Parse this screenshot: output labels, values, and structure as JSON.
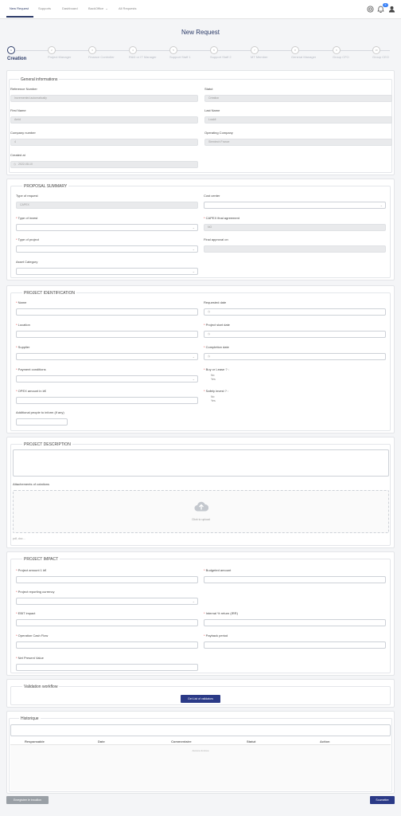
{
  "nav": {
    "tabs": [
      "New Request",
      "Supports",
      "Dashboard",
      "BackOffice",
      "All Requests"
    ],
    "backoffice_chevron": "⌄",
    "notification_count": "0"
  },
  "page_title": "New Request",
  "stepper": {
    "steps": [
      {
        "num": "1",
        "label": "Creation"
      },
      {
        "num": "2",
        "label": "Project Manager"
      },
      {
        "num": "3",
        "label": "Finance Controller"
      },
      {
        "num": "4",
        "label": "R&D or IT Manager"
      },
      {
        "num": "5",
        "label": "Support Staff 1"
      },
      {
        "num": "6",
        "label": "Support Staff 2"
      },
      {
        "num": "7",
        "label": "MT Member"
      },
      {
        "num": "8",
        "label": "General Manager"
      },
      {
        "num": "9",
        "label": "Group CFO"
      },
      {
        "num": "10",
        "label": "Group CEO"
      }
    ]
  },
  "general": {
    "legend": "General informations",
    "reference_label": "Reference Number",
    "reference_value": "Incremented automatically",
    "status_label": "Statut",
    "status_value": "Création",
    "first_name_label": "First Name",
    "first_name_value": "Amid",
    "last_name_label": "Last Name",
    "last_name_value": "Lualdi",
    "company_label": "Company number",
    "company_value": "4",
    "operating_label": "Operating Company",
    "operating_value": "Siemtech France",
    "created_label": "Created at",
    "created_value": "2022-08-10"
  },
  "summary": {
    "legend": "PROPOSAL SUMMARY",
    "type_request_label": "Type of request",
    "type_request_value": "CAPEX",
    "cost_center_label": "Cost center",
    "type_invest_label": "Type of invest",
    "capex_final_label": "CAPEX final agreement",
    "capex_final_value": "NO",
    "type_project_label": "Type of project",
    "final_approval_label": "Final approval on",
    "asset_category_label": "Asset Category"
  },
  "identification": {
    "legend": "PROJECT IDENTIFICATION",
    "name_label": "Name",
    "requested_label": "Requested date",
    "location_label": "Location",
    "start_label": "Project start date",
    "supplier_label": "Supplier",
    "completion_label": "Completion date",
    "payment_label": "Payment conditions",
    "buy_lease_label": "Buy or Lease ? :",
    "opex_label": "OPEX amount in k€",
    "safety_label": "Safety invest ? :",
    "radio_no": "No",
    "radio_yes": "Yes",
    "additional_label": "Additional people to inform (if any)"
  },
  "description": {
    "legend": "PROJECT DESCRIPTION",
    "attachments_label": "Attachements of cotations",
    "upload_label": "Click to upload",
    "upload_hint": "pdf, doc ..."
  },
  "impact": {
    "legend": "PROJECT IMPACT",
    "amount_label": "Project amount 1 k€",
    "budgeted_label": "Budgeted amount",
    "currency_label": "Project reporting currency",
    "ebit_label": "EBIT impact",
    "irr_label": "Internal % return (IRR)",
    "ocf_label": "Operation Cash Flow",
    "payback_label": "Payback period",
    "npv_label": "Net Present Value"
  },
  "workflow": {
    "legend": "Validation workflow",
    "button": "Get List of validators"
  },
  "historique": {
    "legend": "Historique",
    "columns": [
      "Responsable",
      "Date",
      "Commentaire",
      "Statut",
      "Action"
    ],
    "empty": "Aucune donnée"
  },
  "footer": {
    "draft_button": "Enregistrer le brouillon",
    "submit_button": "Soumettre"
  },
  "colors": {
    "primary": "#2b3a67",
    "button": "#2b3a87",
    "badge": "#3b82f6",
    "required": "#dd3333"
  }
}
